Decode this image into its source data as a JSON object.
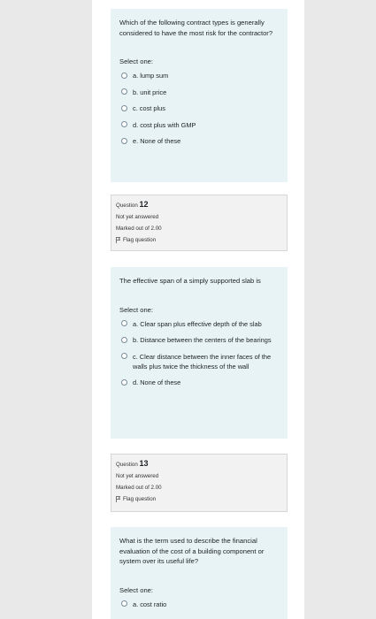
{
  "q11": {
    "text": "Which of the following contract types is generally considered to have the most risk for the contractor?",
    "prompt": "Select one:",
    "options": [
      "a. lump sum",
      "b. unit price",
      "c. cost plus",
      "d. cost plus with GMP",
      "e. None of these"
    ]
  },
  "info12": {
    "question_label": "Question",
    "number": "12",
    "status": "Not yet answered",
    "marked": "Marked out of 2.00",
    "flag": "Flag question"
  },
  "q12": {
    "text": "The effective span of a simply supported slab is",
    "prompt": "Select one:",
    "options": [
      "a. Clear span plus effective depth of the slab",
      "b. Distance between the centers of the bearings",
      "c. Clear distance between the inner faces of the walls plus twice the thickness of the wall",
      "d. None of these"
    ]
  },
  "info13": {
    "question_label": "Question",
    "number": "13",
    "status": "Not yet answered",
    "marked": "Marked out of 2.00",
    "flag": "Flag question"
  },
  "q13": {
    "text": "What is the term used to describe the financial evaluation of the cost of a building component or system over its useful life?",
    "prompt": "Select one:",
    "options": [
      "a. cost ratio"
    ]
  }
}
